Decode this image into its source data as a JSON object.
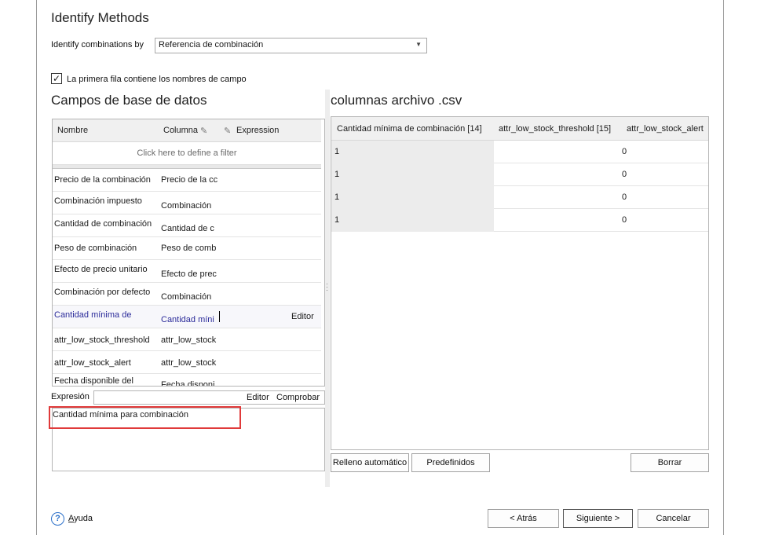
{
  "dialog": {
    "title": "Identify Methods"
  },
  "identify": {
    "label": "Identify combinations by",
    "selected": "Referencia de combinación"
  },
  "first_row_header": {
    "checked": true,
    "checkmark": "✓",
    "label": "La primera fila contiene los nombres de campo"
  },
  "db_fields": {
    "title": "Campos de base de datos",
    "columns": {
      "name": "Nombre",
      "column": "Columna",
      "expression": "Expression"
    },
    "filter_placeholder": "Click here to define a filter",
    "rows": [
      {
        "name": "Precio de la combinación",
        "column": "Precio de la cc"
      },
      {
        "name": "Combinación impuesto",
        "column": "Combinación"
      },
      {
        "name": "Cantidad de combinación",
        "column": "Cantidad de c"
      },
      {
        "name": "Peso de combinación",
        "column": "Peso de comb"
      },
      {
        "name": "Efecto de precio unitario",
        "column": "Efecto de prec"
      },
      {
        "name": "Combinación por defecto",
        "column": "Combinación"
      },
      {
        "name": "Cantidad mínima de",
        "column": "Cantidad míni",
        "editor": "Editor"
      },
      {
        "name": "attr_low_stock_threshold",
        "column": "attr_low_stock"
      },
      {
        "name": "attr_low_stock_alert",
        "column": "attr_low_stock"
      },
      {
        "name": "Fecha disponible del",
        "column": "Fecha disponi"
      }
    ]
  },
  "expression": {
    "label": "Expresión",
    "editor_button": "Editor",
    "check_button": "Comprobar",
    "text": "Cantidad mínima para combinación"
  },
  "csv": {
    "title": "columnas archivo .csv",
    "headers": [
      "Cantidad mínima de combinación [14]",
      "attr_low_stock_threshold [15]",
      "attr_low_stock_alert"
    ],
    "rows": [
      [
        "1",
        "0"
      ],
      [
        "1",
        "0"
      ],
      [
        "1",
        "0"
      ],
      [
        "1",
        "0"
      ]
    ],
    "buttons": {
      "autofill": "Relleno automático",
      "defaults": "Predefinidos",
      "clear": "Borrar"
    }
  },
  "footer": {
    "help": "Ayuda",
    "help_icon": "?",
    "back": "< Atrás",
    "next": "Siguiente >",
    "cancel": "Cancelar"
  }
}
